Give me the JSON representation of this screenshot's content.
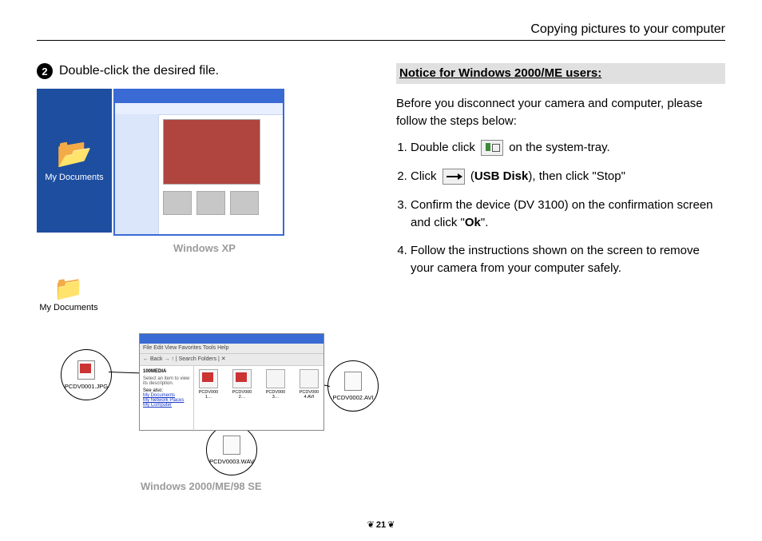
{
  "header": "Copying pictures to your computer",
  "step": {
    "number": "2",
    "text": "Double-click the desired file."
  },
  "xp": {
    "desktop_label": "My Documents",
    "caption": "Windows XP"
  },
  "docs_icon_label": "My Documents",
  "explorer": {
    "title": "100MEDIA",
    "menu": "File  Edit  View  Favorites  Tools  Help",
    "toolbar": "← Back  →  ↑  | Search  Folders  | ✕",
    "side_heading": "100MEDIA",
    "side_desc": "Select an item to view its description.",
    "side_seealso": "See also:",
    "links": [
      "My Documents",
      "My Network Places",
      "My Computer"
    ],
    "files": [
      "PCDV0001…",
      "PCDV0002…",
      "PCDV0003…",
      "PCDV0004.AVI"
    ]
  },
  "callouts": {
    "jpg": "PCDV0001.JPG",
    "avi": "PCDV0002.AVI",
    "wav": "PCDV0003.WAV"
  },
  "caption2": "Windows 2000/ME/98 SE",
  "notice": {
    "heading": "Notice for Windows 2000/ME users:",
    "intro": "Before you disconnect your camera and computer, please follow the steps below:",
    "s1a": "Double click",
    "s1b": "on the system-tray.",
    "s2a": "Click",
    "s2b_open": "(",
    "s2b_bold": "USB Disk",
    "s2b_close": "), then click \"Stop\"",
    "s3a": "Confirm the device (DV 3100) on the confirmation screen and click \"",
    "s3b_bold": "Ok",
    "s3c": "\".",
    "s4": "Follow the instructions shown on the screen to remove your camera from your computer safely."
  },
  "page_number": "21"
}
